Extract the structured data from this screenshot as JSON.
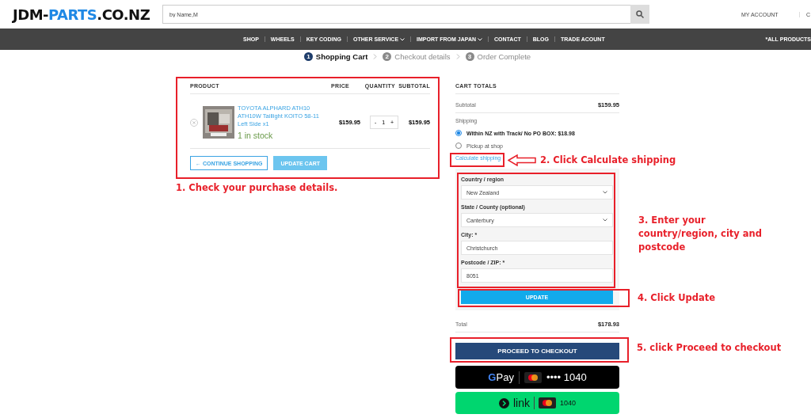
{
  "header": {
    "logo_start": "JDM-",
    "logo_highlight": "PARTS",
    "logo_end": ".CO.NZ",
    "search": {
      "placeholder": "by Name,M"
    },
    "account_links": [
      "MY ACCOUNT",
      "C"
    ]
  },
  "nav": {
    "items": [
      {
        "label": "SHOP",
        "dropdown": false
      },
      {
        "label": "WHEELS",
        "dropdown": false
      },
      {
        "label": "KEY CODING",
        "dropdown": false
      },
      {
        "label": "OTHER SERVICE",
        "dropdown": true
      },
      {
        "label": "IMPORT FROM JAPAN",
        "dropdown": true
      },
      {
        "label": "CONTACT",
        "dropdown": false
      },
      {
        "label": "BLOG",
        "dropdown": false
      },
      {
        "label": "TRADE ACOUNT",
        "dropdown": false
      }
    ],
    "right_link": "*ALL PRODUCTS"
  },
  "steps": [
    {
      "number": "1",
      "label": "Shopping Cart",
      "selected": true
    },
    {
      "number": "2",
      "label": "Checkout details",
      "selected": false
    },
    {
      "number": "3",
      "label": "Order Complete",
      "selected": false
    }
  ],
  "cart": {
    "columns": [
      "PRODUCT",
      "PRICE",
      "QUANTITY",
      "SUBTOTAL"
    ],
    "items": [
      {
        "name": "TOYOTA ALPHARD ATH10 ATH10W Taillight KOITO 58-11 Left Side x1",
        "stock": "1 in stock",
        "price": "$159.95",
        "minus": "-",
        "quantity": "1",
        "plus": "+",
        "subtotal": "$159.95"
      }
    ],
    "continue_button": "← CONTINUE SHOPPING",
    "update_button": "UPDATE CART"
  },
  "totals": {
    "title": "CART TOTALS",
    "subtotal_label": "Subtotal",
    "subtotal": "$159.95",
    "shipping_label": "Shipping",
    "shipping_options": [
      {
        "label": "Within NZ with Track/ No PO BOX: $18.98",
        "selected": true
      },
      {
        "label": "Pickup at shop",
        "selected": false
      }
    ],
    "calculate_link": "Calculate shipping",
    "fields": [
      {
        "label": "Country / region",
        "kind": "select",
        "value": "New Zealand"
      },
      {
        "label": "State / County (optional)",
        "kind": "select",
        "value": "Canterbury"
      },
      {
        "label": "City: *",
        "kind": "text",
        "value": "Christchurch"
      },
      {
        "label": "Postcode / ZIP: *",
        "kind": "text",
        "value": "8051"
      }
    ],
    "update_button": "UPDATE",
    "total_label": "Total",
    "total": "$178.93",
    "checkout_button": "PROCEED TO CHECKOUT",
    "gpay": {
      "g": "G",
      "word": "Pay",
      "card": "•••• 1040"
    },
    "link_pay": {
      "word": "link",
      "card": "1040"
    }
  },
  "annotations": [
    "1. Check your purchase details.",
    "2. Click Calculate shipping",
    "3. Enter your country/region, city and postcode",
    "4. Click Update",
    "5. click Proceed to checkout"
  ]
}
